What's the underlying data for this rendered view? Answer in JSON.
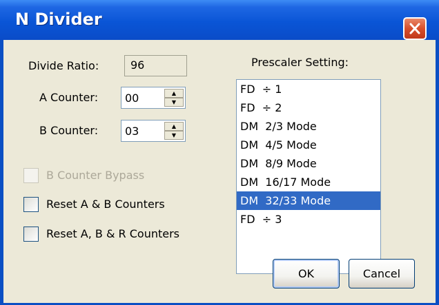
{
  "window": {
    "title": "N Divider",
    "close_glyph": "✕"
  },
  "divide_ratio": {
    "label": "Divide Ratio:",
    "value": "96"
  },
  "a_counter": {
    "label": "A Counter:",
    "value": "00",
    "up_glyph": "▲",
    "down_glyph": "▼"
  },
  "b_counter": {
    "label": "B Counter:",
    "value": "03",
    "up_glyph": "▲",
    "down_glyph": "▼"
  },
  "checkboxes": [
    {
      "label": "B Counter Bypass",
      "checked": false,
      "enabled": false
    },
    {
      "label": "Reset A & B Counters",
      "checked": false,
      "enabled": true
    },
    {
      "label": "Reset A, B & R Counters",
      "checked": false,
      "enabled": true
    }
  ],
  "prescaler": {
    "label": "Prescaler Setting:",
    "options": [
      "FD  ÷ 1",
      "FD  ÷ 2",
      "DM  2/3 Mode",
      "DM  4/5 Mode",
      "DM  8/9 Mode",
      "DM  16/17 Mode",
      "DM  32/33 Mode",
      "FD  ÷ 3"
    ],
    "selected": "DM  32/33 Mode"
  },
  "buttons": {
    "ok": "OK",
    "cancel": "Cancel"
  },
  "colors": {
    "title_bar": "#0a55d6",
    "selection": "#316ac5",
    "dialog_bg": "#ece9d8"
  }
}
